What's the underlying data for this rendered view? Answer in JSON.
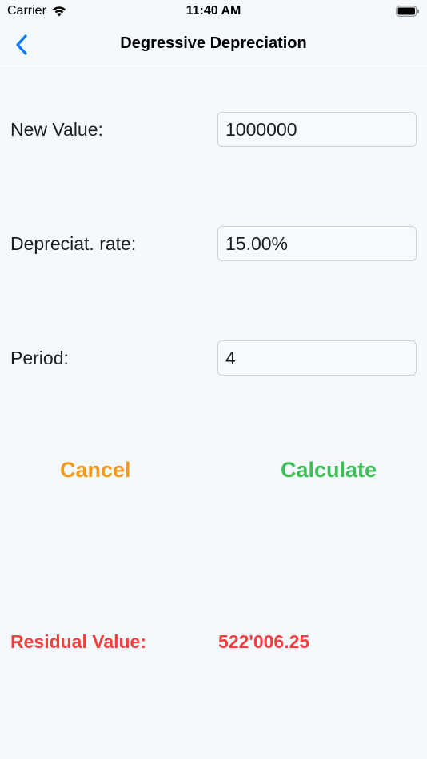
{
  "status_bar": {
    "carrier": "Carrier",
    "time": "11:40 AM",
    "wifi_icon": "wifi-icon",
    "battery_icon": "battery-icon"
  },
  "nav": {
    "title": "Degressive Depreciation",
    "back_icon": "chevron-left-icon",
    "accent_color": "#0A7AFF"
  },
  "form": {
    "new_value": {
      "label": "New Value:",
      "value": "1000000"
    },
    "depreciation_rate": {
      "label": "Depreciat. rate:",
      "value": "15.00%"
    },
    "period": {
      "label": "Period:",
      "value": "4"
    }
  },
  "actions": {
    "cancel_label": "Cancel",
    "calculate_label": "Calculate",
    "cancel_color": "#F39A1E",
    "calculate_color": "#3EBE57"
  },
  "result": {
    "label": "Residual Value:",
    "value": "522'006.25",
    "color": "#F43E3E"
  }
}
